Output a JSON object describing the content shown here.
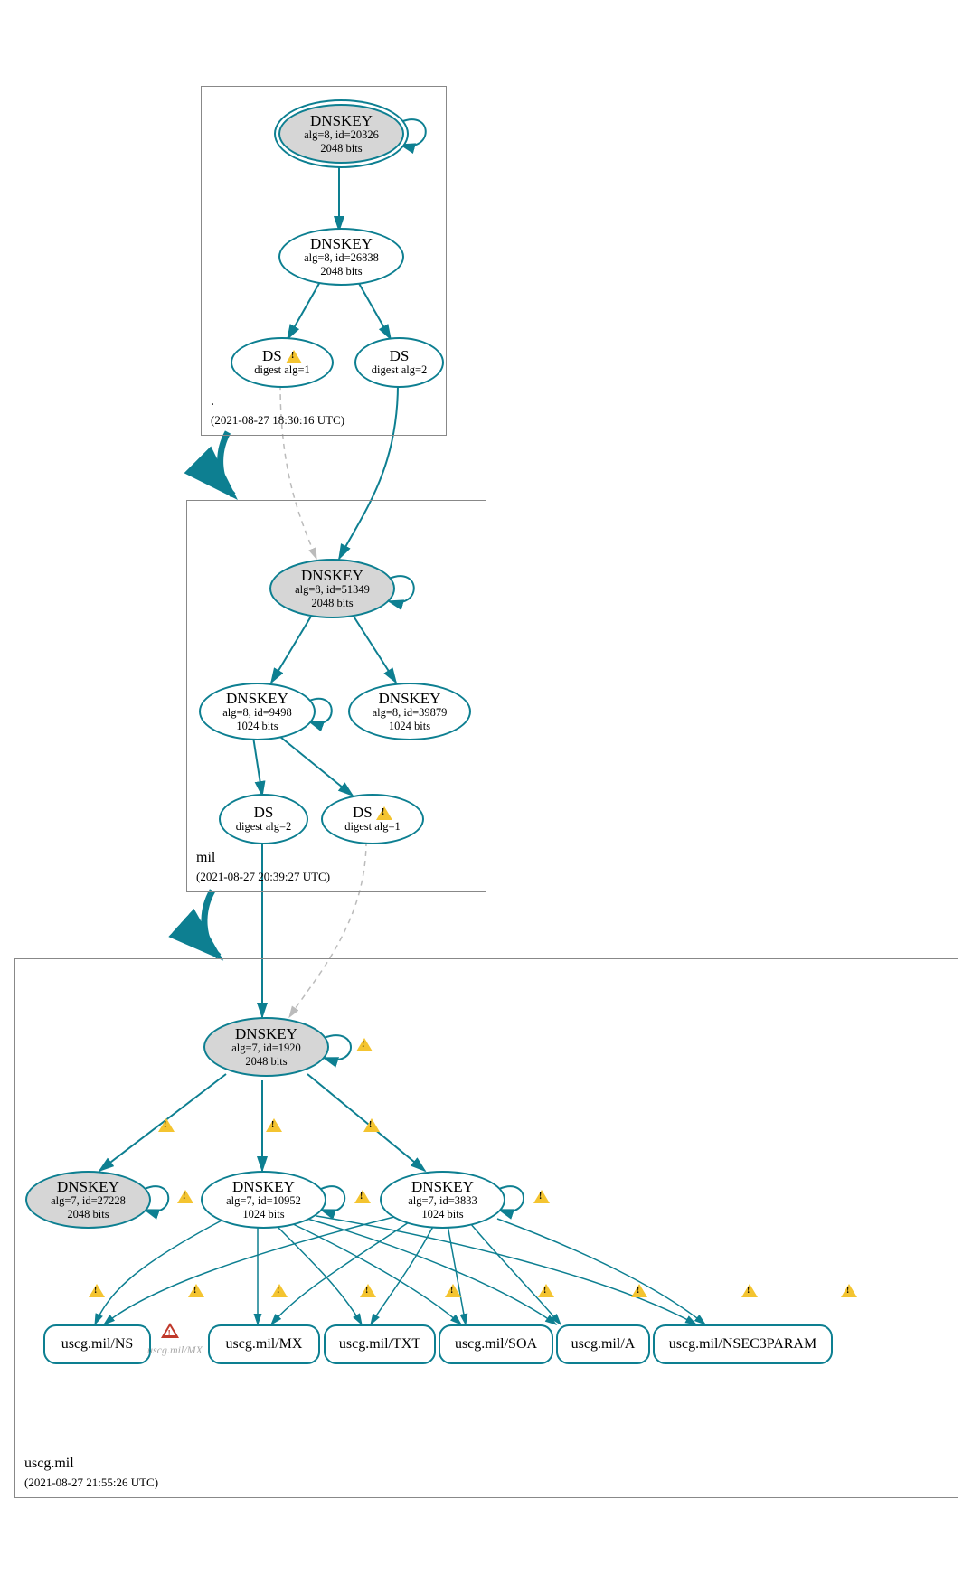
{
  "zones": {
    "root": {
      "name": ".",
      "timestamp": "(2021-08-27 18:30:16 UTC)"
    },
    "mil": {
      "name": "mil",
      "timestamp": "(2021-08-27 20:39:27 UTC)"
    },
    "uscg": {
      "name": "uscg.mil",
      "timestamp": "(2021-08-27 21:55:26 UTC)"
    }
  },
  "nodes": {
    "root_ksk": {
      "title": "DNSKEY",
      "line1": "alg=8, id=20326",
      "line2": "2048 bits"
    },
    "root_zsk": {
      "title": "DNSKEY",
      "line1": "alg=8, id=26838",
      "line2": "2048 bits"
    },
    "root_ds1": {
      "title": "DS",
      "line1": "digest alg=1",
      "warn": true
    },
    "root_ds2": {
      "title": "DS",
      "line1": "digest alg=2"
    },
    "mil_ksk": {
      "title": "DNSKEY",
      "line1": "alg=8, id=51349",
      "line2": "2048 bits"
    },
    "mil_zsk1": {
      "title": "DNSKEY",
      "line1": "alg=8, id=9498",
      "line2": "1024 bits"
    },
    "mil_zsk2": {
      "title": "DNSKEY",
      "line1": "alg=8, id=39879",
      "line2": "1024 bits"
    },
    "mil_ds2": {
      "title": "DS",
      "line1": "digest alg=2"
    },
    "mil_ds1": {
      "title": "DS",
      "line1": "digest alg=1",
      "warn": true
    },
    "uscg_ksk": {
      "title": "DNSKEY",
      "line1": "alg=7, id=1920",
      "line2": "2048 bits"
    },
    "uscg_k27228": {
      "title": "DNSKEY",
      "line1": "alg=7, id=27228",
      "line2": "2048 bits"
    },
    "uscg_k10952": {
      "title": "DNSKEY",
      "line1": "alg=7, id=10952",
      "line2": "1024 bits"
    },
    "uscg_k3833": {
      "title": "DNSKEY",
      "line1": "alg=7, id=3833",
      "line2": "1024 bits"
    }
  },
  "rrsets": {
    "ns": "uscg.mil/NS",
    "mx": "uscg.mil/MX",
    "txt": "uscg.mil/TXT",
    "soa": "uscg.mil/SOA",
    "a": "uscg.mil/A",
    "nsec3": "uscg.mil/NSEC3PARAM"
  },
  "error": {
    "label": "uscg.mil/MX"
  }
}
